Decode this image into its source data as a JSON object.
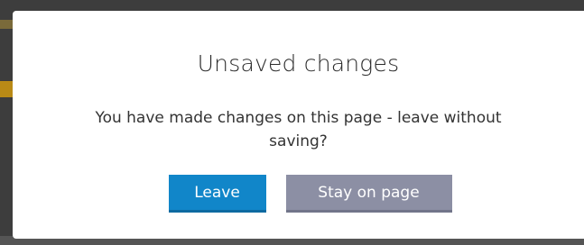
{
  "dialog": {
    "title": "Unsaved changes",
    "message": "You have made changes on this page - leave without saving?",
    "buttons": {
      "leave_label": "Leave",
      "stay_label": "Stay on page"
    }
  },
  "colors": {
    "primary_button": "#1186c9",
    "secondary_button": "#8c8fa4",
    "backdrop": "#3d3d3d"
  }
}
